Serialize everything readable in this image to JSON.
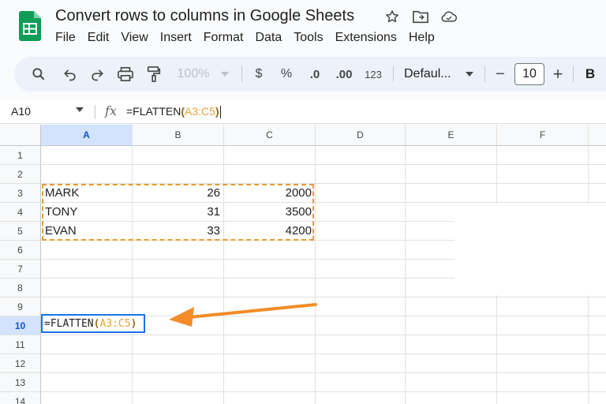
{
  "app": {
    "document_title": "Convert rows to columns in Google Sheets",
    "menu": [
      "File",
      "Edit",
      "View",
      "Insert",
      "Format",
      "Data",
      "Tools",
      "Extensions",
      "Help"
    ]
  },
  "toolbar": {
    "zoom": "100%",
    "currency": "$",
    "percent": "%",
    "decrease_decimal": ".0",
    "increase_decimal": ".00",
    "number_format": "123",
    "font": "Defaul...",
    "font_size": "10",
    "bold": "B",
    "minus": "−",
    "plus": "+"
  },
  "formula_bar": {
    "cell_ref": "A10",
    "fx": "fx",
    "formula_prefix": "=FLATTEN",
    "formula_open": "(",
    "formula_range": "A3:C5",
    "formula_close": ")"
  },
  "sheet": {
    "columns": [
      "A",
      "B",
      "C",
      "D",
      "E",
      "F"
    ],
    "rows": [
      "1",
      "2",
      "3",
      "4",
      "5",
      "6",
      "7",
      "8",
      "9",
      "10",
      "11",
      "12",
      "13",
      "14"
    ],
    "selected_column": "A",
    "selected_row": "10",
    "data": [
      {
        "name": "MARK",
        "b": "26",
        "c": "2000"
      },
      {
        "name": "TONY",
        "b": "31",
        "c": "3500"
      },
      {
        "name": "EVAN",
        "b": "33",
        "c": "4200"
      }
    ],
    "editor": {
      "prefix": "=FLATTEN",
      "open": "(",
      "range": "A3:C5",
      "close": ")"
    }
  },
  "colors": {
    "selection_blue": "#1a73e8",
    "header_selected": "#d3e3fd",
    "range_orange": "#e69b31",
    "arrow_orange": "#f28c28"
  },
  "icons": [
    "sheets-logo-icon",
    "star-icon",
    "move-to-folder-icon",
    "cloud-status-icon",
    "search-icon",
    "undo-icon",
    "redo-icon",
    "print-icon",
    "paint-format-icon",
    "chevron-down-icon"
  ]
}
